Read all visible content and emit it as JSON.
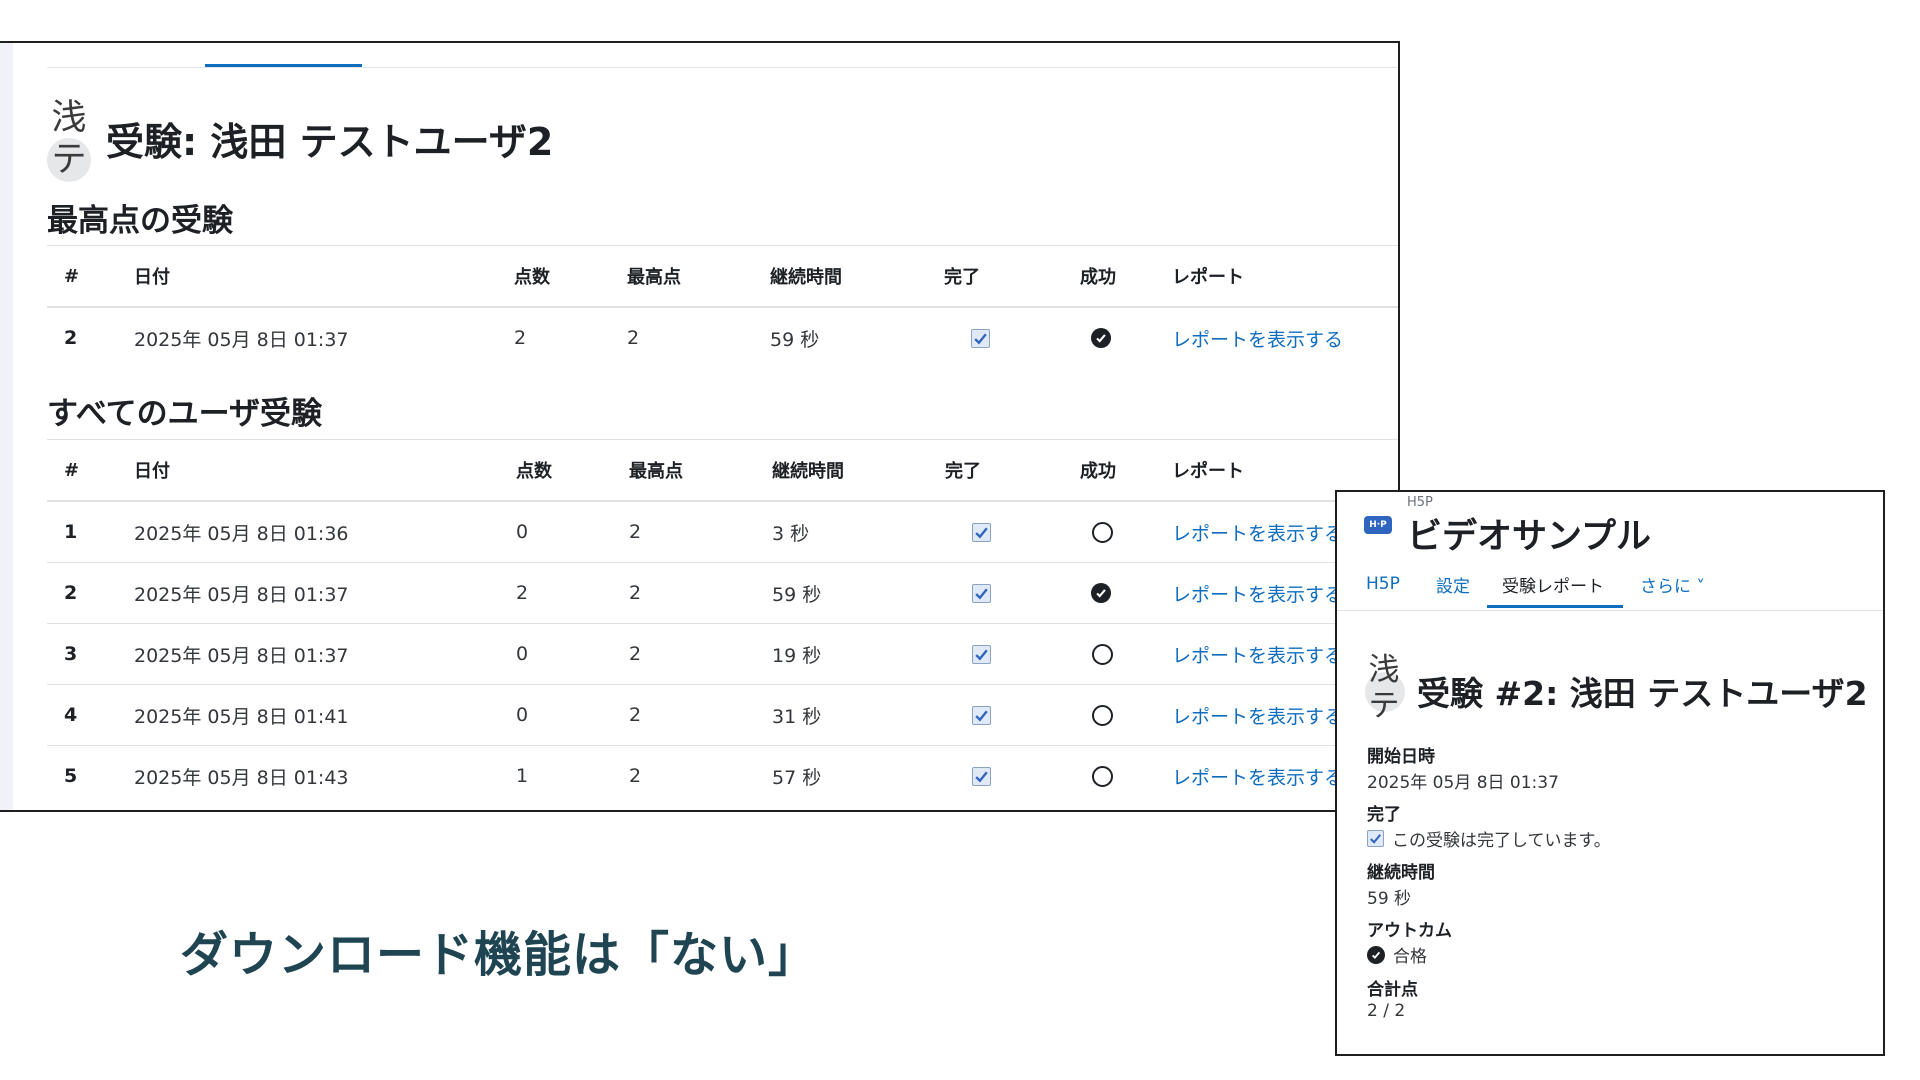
{
  "left": {
    "avatar_initials": "浅テ",
    "page_title": "受験: 浅田 テストユーザ2",
    "best_section_title": "最高点の受験",
    "all_section_title": "すべてのユーザ受験",
    "columns": [
      "#",
      "日付",
      "点数",
      "最高点",
      "継続時間",
      "完了",
      "成功",
      "レポート"
    ],
    "best_attempt": {
      "num": "2",
      "date": "2025年 05月 8日 01:37",
      "score": "2",
      "max": "2",
      "duration": "59 秒",
      "completed": true,
      "success": true,
      "report": "レポートを表示する"
    },
    "attempts": [
      {
        "num": "1",
        "date": "2025年 05月 8日 01:36",
        "score": "0",
        "max": "2",
        "duration": "3 秒",
        "completed": true,
        "success": false,
        "report": "レポートを表示する"
      },
      {
        "num": "2",
        "date": "2025年 05月 8日 01:37",
        "score": "2",
        "max": "2",
        "duration": "59 秒",
        "completed": true,
        "success": true,
        "report": "レポートを表示する"
      },
      {
        "num": "3",
        "date": "2025年 05月 8日 01:37",
        "score": "0",
        "max": "2",
        "duration": "19 秒",
        "completed": true,
        "success": false,
        "report": "レポートを表示する"
      },
      {
        "num": "4",
        "date": "2025年 05月 8日 01:41",
        "score": "0",
        "max": "2",
        "duration": "31 秒",
        "completed": true,
        "success": false,
        "report": "レポートを表示する"
      },
      {
        "num": "5",
        "date": "2025年 05月 8日 01:43",
        "score": "1",
        "max": "2",
        "duration": "57 秒",
        "completed": true,
        "success": false,
        "report": "レポートを表示する"
      }
    ]
  },
  "caption": "ダウンロード機能は「ない」",
  "right": {
    "badge": "H·P",
    "module_type": "H5P",
    "module_title": "ビデオサンプル",
    "tabs": [
      "H5P",
      "設定",
      "受験レポート",
      "さらに ˅"
    ],
    "active_tab": "受験レポート",
    "avatar_initials": "浅テ",
    "attempt_title": "受験 #2: 浅田 テストユーザ2",
    "fields": {
      "start_label": "開始日時",
      "start_value": "2025年 05月 8日 01:37",
      "complete_label": "完了",
      "complete_value": "この受験は完了しています。",
      "duration_label": "継続時間",
      "duration_value": "59 秒",
      "outcome_label": "アウトカム",
      "outcome_value": "合格",
      "total_label": "合計点",
      "total_value": "2 / 2"
    }
  },
  "colors": {
    "link": "#0f6cbf",
    "caption": "#1f4452",
    "h5p_badge": "#2f64bf"
  }
}
